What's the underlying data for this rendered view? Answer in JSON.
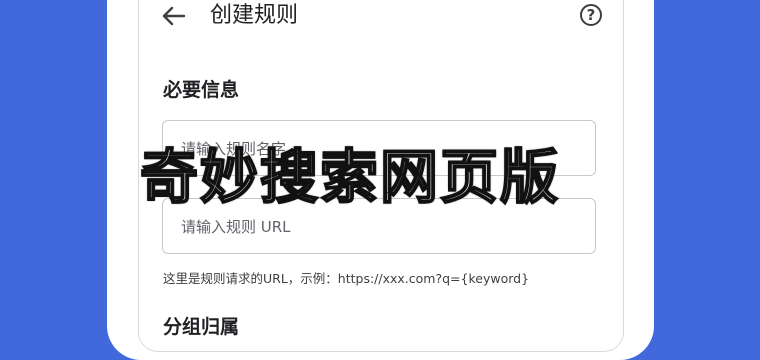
{
  "header": {
    "title": "创建规则",
    "back_icon": "arrow-left-icon",
    "help_icon": "question-circle-icon",
    "help_glyph": "?"
  },
  "sections": {
    "required_info": "必要信息",
    "group": "分组归属"
  },
  "fields": {
    "rule_name_placeholder": "请输入规则名字",
    "rule_url_placeholder": "请输入规则 URL"
  },
  "hint": "这里是规则请求的URL，示例：https://xxx.com?q={keyword}",
  "watermark": "奇妙搜索网页版",
  "colors": {
    "background": "#4169dc",
    "surface": "#ffffff",
    "border": "#c9c9c9"
  }
}
